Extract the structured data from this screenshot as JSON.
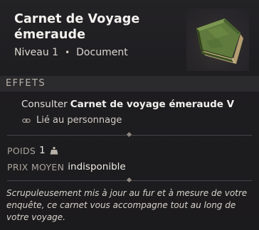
{
  "item": {
    "title_line1": "Carnet de Voyage",
    "title_line2": "émeraude",
    "level": "Niveau 1",
    "separator": "•",
    "type": "Document",
    "image_icon": "green-book-icon"
  },
  "effects": {
    "section_label": "EFFETS",
    "consult_prefix": "Consulter",
    "consult_target": "Carnet de voyage émeraude V",
    "bound_icon": "link-icon",
    "bound_label": "Lié au personnage"
  },
  "stats": {
    "weight_label": "POIDS",
    "weight_value": "1",
    "weight_icon": "weight-icon",
    "price_label": "PRIX MOYEN",
    "price_value": "indisponible"
  },
  "description": "Scrupuleusement mis à jour au fur et à mesure de votre enquête, ce carnet vous accompagne tout au long de votre voyage.",
  "colors": {
    "background": "#1c1b1d",
    "section_bar": "#2b2a2d",
    "book_green": "#5f7a3c",
    "book_pages": "#c9b48a"
  }
}
